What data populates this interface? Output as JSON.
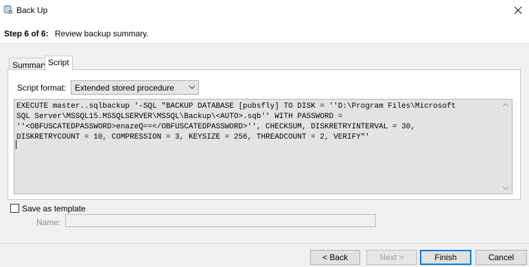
{
  "window": {
    "title": "Back Up",
    "icon": "backup-database-icon",
    "close_icon": "close-icon"
  },
  "step": {
    "label": "Step 6 of 6:",
    "description": "Review backup summary."
  },
  "tabs": [
    {
      "label": "Summary",
      "selected": false
    },
    {
      "label": "Script",
      "selected": true
    }
  ],
  "script": {
    "format_label": "Script format:",
    "format_value": "Extended stored procedure",
    "text": "EXECUTE master..sqlbackup '-SQL \"BACKUP DATABASE [pubsfly] TO DISK = ''D:\\Program Files\\Microsoft\nSQL Server\\MSSQL15.MSSQLSERVER\\MSSQL\\Backup\\<AUTO>.sqb'' WITH PASSWORD =\n''<OBFUSCATEDPASSWORD>enazeQ==</OBFUSCATEDPASSWORD>'', CHECKSUM, DISKRETRYINTERVAL = 30,\nDISKRETRYCOUNT = 10, COMPRESSION = 3, KEYSIZE = 256, THREADCOUNT = 2, VERIFY\"'"
  },
  "template": {
    "save_label": "Save as template",
    "checked": false,
    "name_label": "Name:",
    "name_value": ""
  },
  "buttons": {
    "back": "< Back",
    "next": "Next >",
    "finish": "Finish",
    "cancel": "Cancel"
  },
  "colors": {
    "accent": "#0078d7",
    "dialog_background": "#f0f0f0",
    "script_background": "#e3e3e3"
  }
}
